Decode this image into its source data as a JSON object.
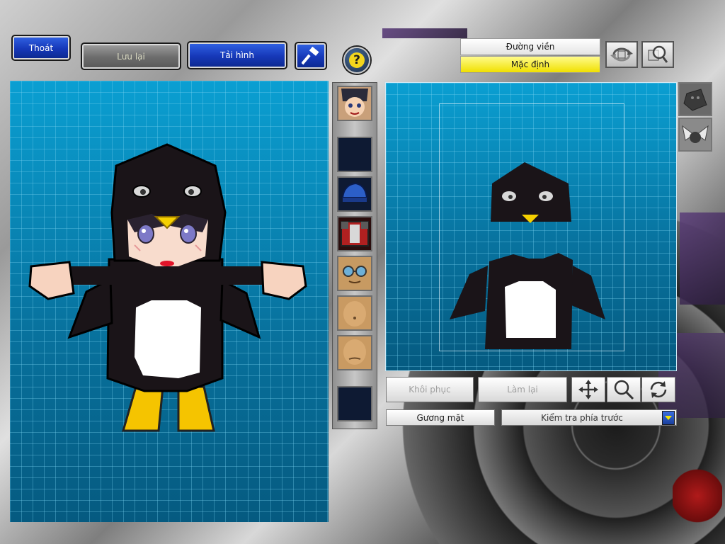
{
  "toolbar": {
    "exit_label": "Thoát",
    "save_label": "Lưu lại",
    "reload_label": "Tải hình",
    "hammer_icon": "hammer-icon",
    "help_icon": "help-icon",
    "help_glyph": "?"
  },
  "view_tabs": {
    "outline_label": "Đường viền",
    "default_label": "Mặc định"
  },
  "view_tools": {
    "rotate_icon": "rotate-view-icon",
    "zoom_icon": "zoom-view-icon"
  },
  "side_tools": [
    "stone-block-icon",
    "wing-emblem-icon"
  ],
  "slots": [
    {
      "name": "face-slot",
      "icon": "anime-face-icon"
    },
    {
      "name": "empty-slot-1",
      "icon": ""
    },
    {
      "name": "helmet-slot",
      "icon": "blue-helmet-icon"
    },
    {
      "name": "armor-slot",
      "icon": "red-armor-icon"
    },
    {
      "name": "goggles-slot",
      "icon": "goggles-icon"
    },
    {
      "name": "body-slot",
      "icon": "belly-icon"
    },
    {
      "name": "lower-body-slot",
      "icon": "lower-body-icon"
    },
    {
      "name": "empty-slot-2",
      "icon": ""
    }
  ],
  "controls": {
    "restore_label": "Khôi phục",
    "redo_label": "Làm lại",
    "move_icon": "move-arrows-icon",
    "zoom_icon": "magnifier-icon",
    "refresh_icon": "refresh-icon",
    "face_label": "Gương mặt",
    "check_select_value": "Kiểm tra phía trước"
  },
  "colors": {
    "blueprint": "#0b6e9a",
    "button_blue": "#1638b8",
    "highlight_yellow": "#f0e000",
    "penguin_black": "#1a1418",
    "beak_yellow": "#f5c400"
  }
}
